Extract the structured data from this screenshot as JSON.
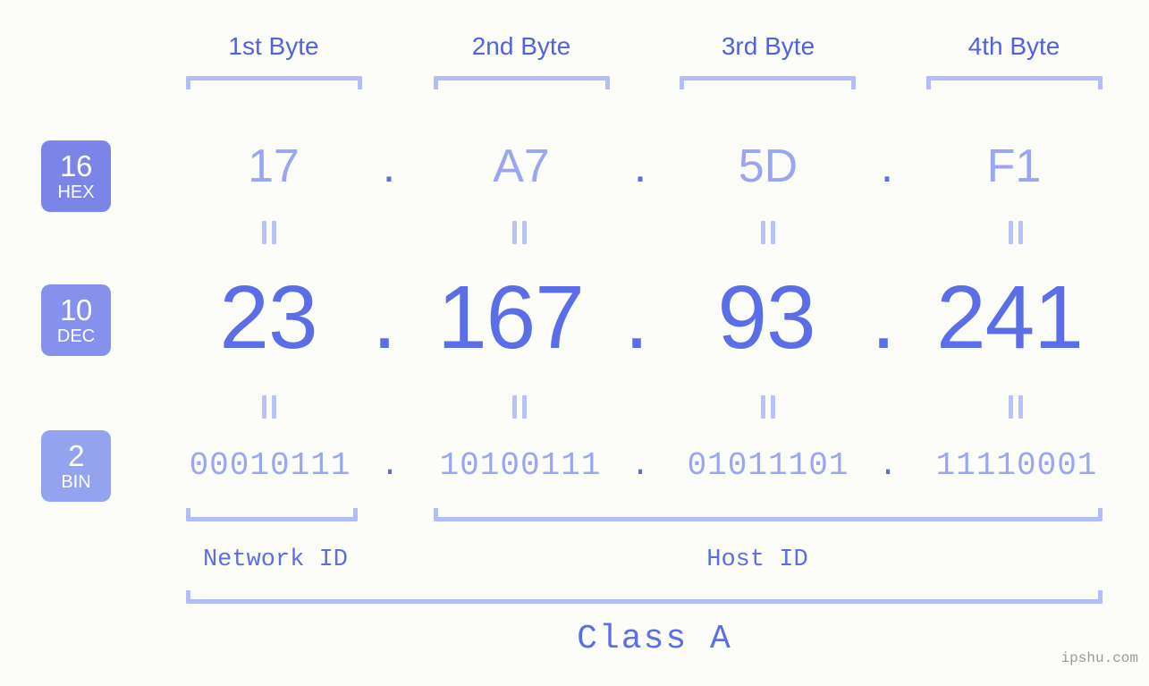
{
  "colors": {
    "background": "#fcfdf8",
    "bracket": "#b3bdf7",
    "header_text": "#4f63e0",
    "hex_text": "#9aa6f2",
    "dec_text": "#5b6ee8",
    "bin_text": "#9aa6f2",
    "badge_hex": "#7b85e8",
    "badge_dec": "#8691ee",
    "badge_bin": "#93a3f0",
    "eq_mark": "#b9c2f7",
    "watermark": "#9b9b9b"
  },
  "byte_headers": [
    {
      "label": "1st Byte"
    },
    {
      "label": "2nd Byte"
    },
    {
      "label": "3rd Byte"
    },
    {
      "label": "4th Byte"
    }
  ],
  "bases": [
    {
      "number": "16",
      "name": "HEX"
    },
    {
      "number": "10",
      "name": "DEC"
    },
    {
      "number": "2",
      "name": "BIN"
    }
  ],
  "separator": ".",
  "rows": {
    "hex": {
      "base_number": "16",
      "base_name": "HEX",
      "values": [
        "17",
        "A7",
        "5D",
        "F1"
      ]
    },
    "dec": {
      "base_number": "10",
      "base_name": "DEC",
      "values": [
        "23",
        "167",
        "93",
        "241"
      ]
    },
    "bin": {
      "base_number": "2",
      "base_name": "BIN",
      "values": [
        "00010111",
        "10100111",
        "01011101",
        "11110001"
      ]
    }
  },
  "equality_marks": {
    "symbol": "=",
    "count_per_row": 4,
    "rows": 2
  },
  "segments": {
    "network_id": {
      "label": "Network ID",
      "bytes": 1
    },
    "host_id": {
      "label": "Host ID",
      "bytes": 3
    }
  },
  "ip_class": {
    "label": "Class A"
  },
  "watermark": {
    "text": "ipshu.com"
  },
  "ip_address": {
    "decimal": "23.167.93.241",
    "hex": "17.A7.5D.F1",
    "binary": "00010111.10100111.01011101.11110001"
  }
}
